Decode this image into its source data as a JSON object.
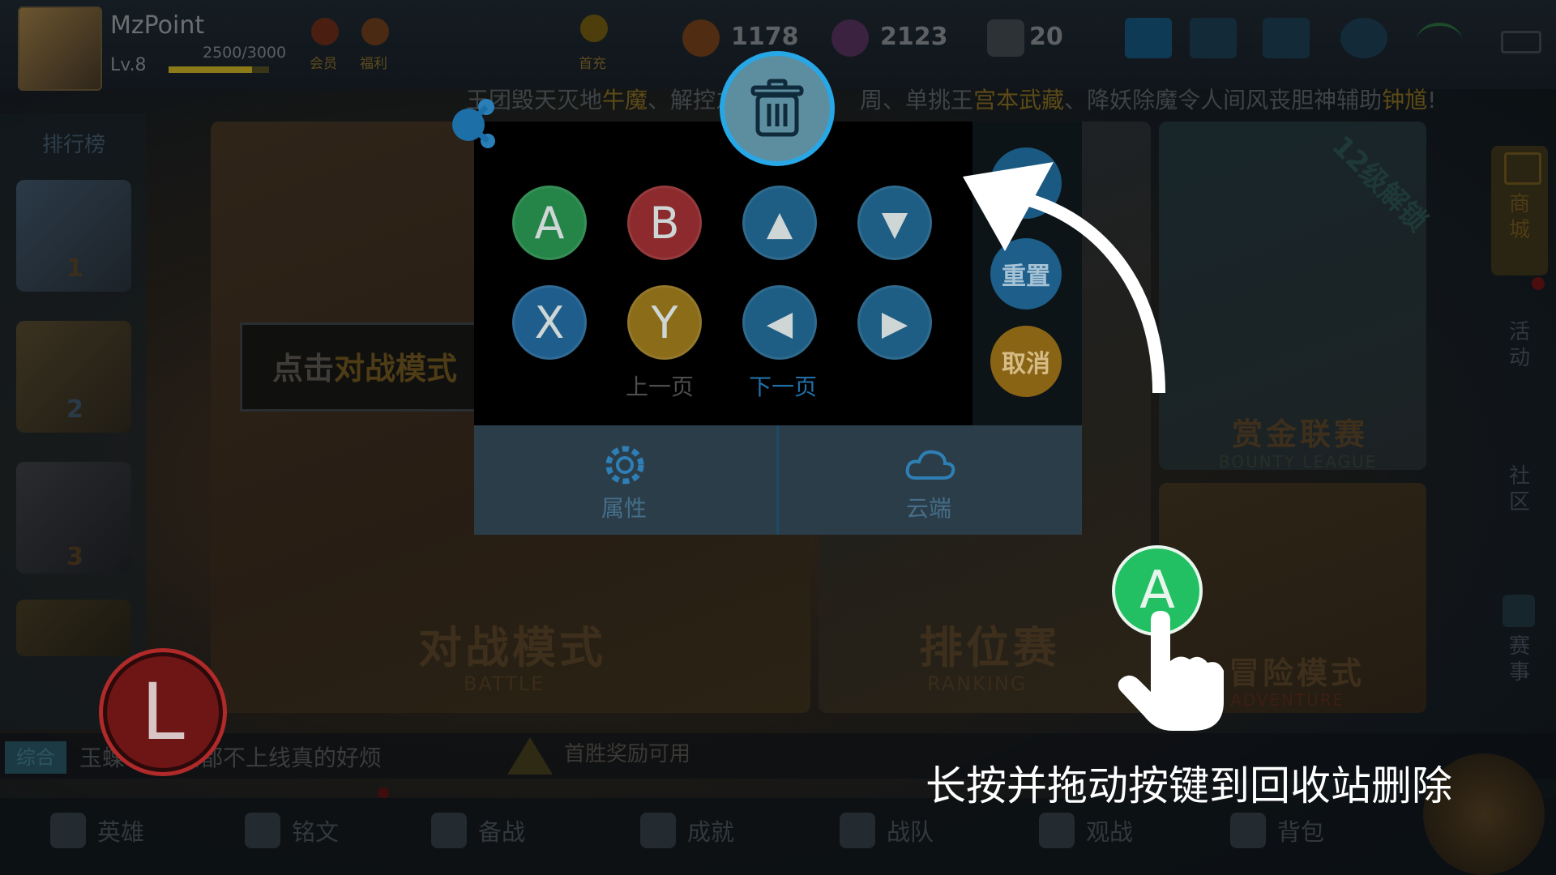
{
  "player": {
    "name": "MzPoint",
    "level": "Lv.8",
    "xp": "2500/3000",
    "xp_ratio": 0.8333
  },
  "top_icons": {
    "member": "会员",
    "welfare": "福利",
    "first_recharge": "首充"
  },
  "resources": {
    "gold": "1178",
    "diamond": "2123",
    "coupons": "20"
  },
  "marquee": {
    "part1": "王团毁天灭地",
    "hl1": "牛魔",
    "part2": "、解控之",
    "part3": "周、单挑王",
    "hl2": "宫本武藏",
    "part4": "、降妖除魔令人间风丧胆神辅助",
    "hl3": "钟馗",
    "part5": "!"
  },
  "ranking": {
    "title": "排行榜",
    "ranks": [
      "1",
      "2",
      "3"
    ]
  },
  "guide": {
    "prefix": "点击",
    "highlight": "对战模式"
  },
  "cards": [
    {
      "title": "对战模式",
      "subtitle": "BATTLE"
    },
    {
      "title": "排位赛",
      "subtitle": "RANKING"
    },
    {
      "title": "赏金联赛",
      "subtitle": "BOUNTY LEAGUE"
    },
    {
      "title": "冒险模式",
      "subtitle": "ADVENTURE"
    }
  ],
  "unlock_banner": "12级解锁",
  "right_nav": [
    "商城",
    "活动",
    "社区",
    "赛事"
  ],
  "chat": {
    "tag": "综合",
    "message": "玉蝶  师傅紧都不上线真的好烦"
  },
  "first_win": "首胜奖励可用",
  "bottom_nav": [
    "英雄",
    "铭文",
    "备战",
    "成就",
    "战队",
    "观战",
    "背包"
  ],
  "keymap": {
    "buttons": [
      "A",
      "B",
      "▲",
      "▼",
      "X",
      "Y",
      "◀",
      "▶"
    ],
    "prev_page": "上一页",
    "next_page": "下一页",
    "side": {
      "reset": "重置",
      "cancel": "取消"
    },
    "footer": {
      "properties": "属性",
      "cloud": "云端"
    }
  },
  "drag_key": "A",
  "joystick_key": "L",
  "hint": "长按并拖动按键到回收站删除",
  "colors": {
    "trash_ring": "#27a7e6",
    "drag_button": "#22c062",
    "joystick": "#b02a2a"
  }
}
